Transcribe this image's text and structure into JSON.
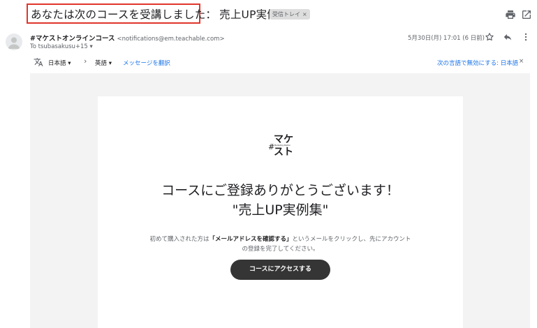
{
  "subject": {
    "highlighted": "あなたは次のコースを受講しました：",
    "rest": "売上UP実例集",
    "label": "受信トレイ",
    "label_close": "×"
  },
  "header_icons": [
    "print-icon",
    "open-in-new-window-icon"
  ],
  "sender": {
    "name": "#マケストオンラインコース",
    "email": "<notifications@em.teachable.com>",
    "to": "To tsubasakusu+15 ▾",
    "date": "5月30日(月) 17:01 (6 日前)"
  },
  "sender_icons": [
    "star-icon",
    "reply-icon",
    "more-vert-icon"
  ],
  "translate": {
    "source_lang": "日本語 ▾",
    "arrow": "›",
    "target_lang": "英語 ▾",
    "translate_link": "メッセージを翻訳",
    "disable_link": "次の言語で無効にする: 日本語",
    "close": "×"
  },
  "email": {
    "logo_hash": "#",
    "logo_line1": "マケ",
    "logo_line2": "スト",
    "logo_sub": "Marketing Station",
    "heading_line1": "コースにご登録ありがとうございます！",
    "heading_line2": "\"売上UP実例集\"",
    "body_prefix": "初めて購入された方は",
    "body_bold": "「メールアドレスを確認する」",
    "body_suffix": "というメールをクリックし、先にアカウント",
    "body_line2": "の登録を完了してください。",
    "cta": "コースにアクセスする"
  },
  "colors": {
    "highlight_border": "#e0352b",
    "link": "#1a73e8",
    "cta_bg": "#353535",
    "body_bg": "#f3f3f3"
  }
}
